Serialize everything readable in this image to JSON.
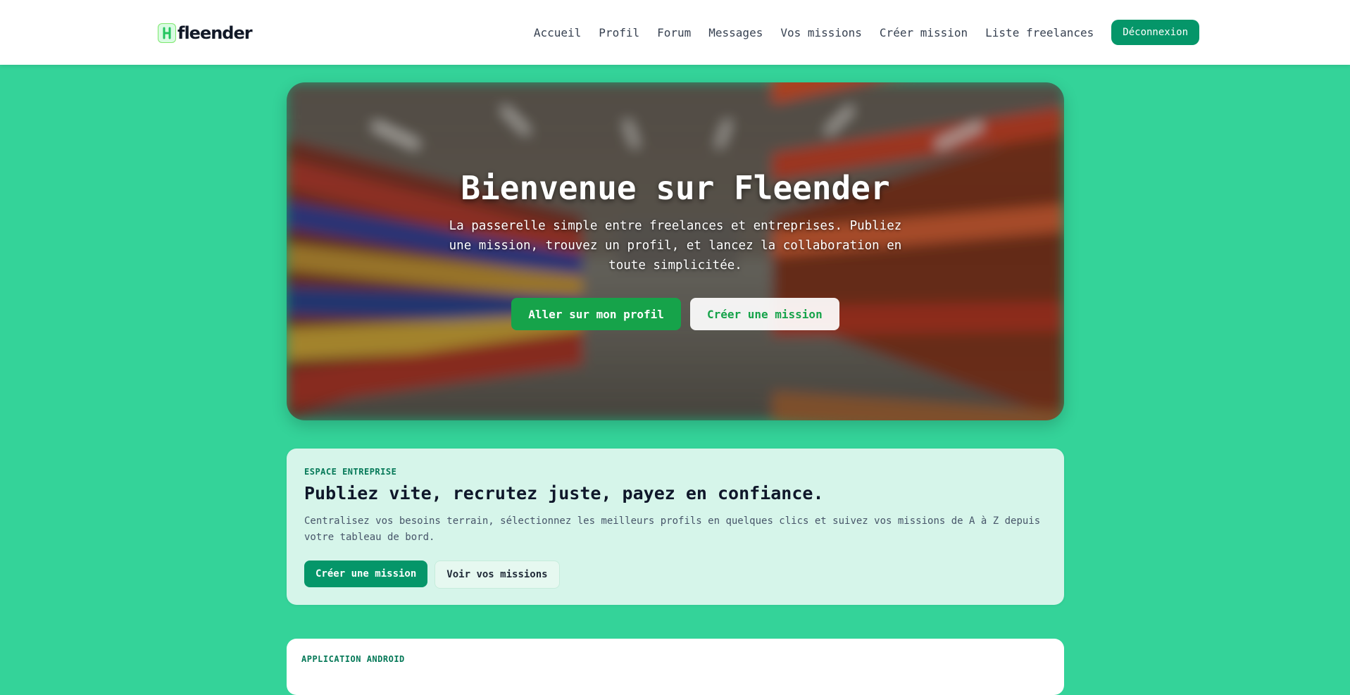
{
  "brand": {
    "name": "fleender",
    "primary_color": "#34d399",
    "accent_color": "#059669"
  },
  "nav": {
    "links": [
      "Accueil",
      "Profil",
      "Forum",
      "Messages",
      "Vos missions",
      "Créer mission",
      "Liste freelances"
    ],
    "logout_label": "Déconnexion"
  },
  "hero": {
    "title": "Bienvenue sur Fleender",
    "subtitle": "La passerelle simple entre freelances et entreprises. Publiez une mission, trouvez un profil, et lancez la collaboration en toute simplicitée.",
    "primary_button": "Aller sur mon profil",
    "secondary_button": "Créer une mission"
  },
  "enterprise": {
    "eyebrow": "ESPACE ENTREPRISE",
    "title": "Publiez vite, recrutez juste, payez en confiance.",
    "description": "Centralisez vos besoins terrain, sélectionnez les meilleurs profils en quelques clics et suivez vos missions de A à Z depuis votre tableau de bord.",
    "primary_button": "Créer une mission",
    "secondary_button": "Voir vos missions"
  },
  "android": {
    "eyebrow": "APPLICATION ANDROID"
  }
}
